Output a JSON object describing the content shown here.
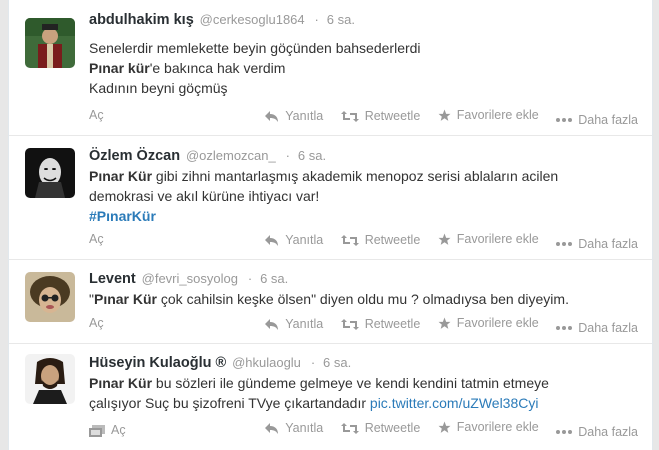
{
  "tweets": [
    {
      "fullname": "abdulhakim kış",
      "handle": "@cerkesoglu1864",
      "time": "6 sa.",
      "lines": [
        {
          "text": "Senelerdir memlekette beyin göçünden bahsederlerdi"
        },
        {
          "bold": "Pınar kür",
          "text": "'e bakınca hak verdim"
        },
        {
          "text": "Kadının beyni göçmüş"
        }
      ],
      "expand": "Aç"
    },
    {
      "fullname": "Özlem Özcan",
      "handle": "@ozlemozcan_",
      "time": "6 sa.",
      "lines": [
        {
          "bold": "Pınar Kür",
          "text": " gibi zihni mantarlaşmış akademik menopoz serisi ablaların acilen"
        },
        {
          "text": "demokrasi ve akıl kürüne ihtiyacı var!"
        },
        {
          "hashtag": "#PınarKür"
        }
      ],
      "expand": "Aç"
    },
    {
      "fullname": "Levent",
      "handle": "@fevri_sosyolog",
      "time": "6 sa.",
      "lines": [
        {
          "pre": "\"",
          "bold": "Pınar Kür",
          "text": " çok cahilsin keşke ölsen\" diyen oldu mu ? olmadıysa ben diyeyim."
        }
      ],
      "expand": "Aç"
    },
    {
      "fullname": "Hüseyin Kulaoğlu ®",
      "handle": "@hkulaoglu",
      "time": "6 sa.",
      "lines": [
        {
          "bold": "Pınar Kür",
          "text": " bu sözleri ile gündeme gelmeye ve kendi kendini tatmin etmeye"
        },
        {
          "text": "çalışıyor Suç bu şizofreni TVye çıkartandadır ",
          "link": "pic.twitter.com/uZWel38Cyi"
        }
      ],
      "expand": "Aç"
    }
  ],
  "actions": {
    "reply": "Yanıtla",
    "retweet": "Retweetle",
    "favorite": "Favorilere ekle",
    "more": "Daha fazla"
  },
  "colors": {
    "link": "#2b7bb9",
    "muted": "#999999",
    "text": "#333333"
  }
}
